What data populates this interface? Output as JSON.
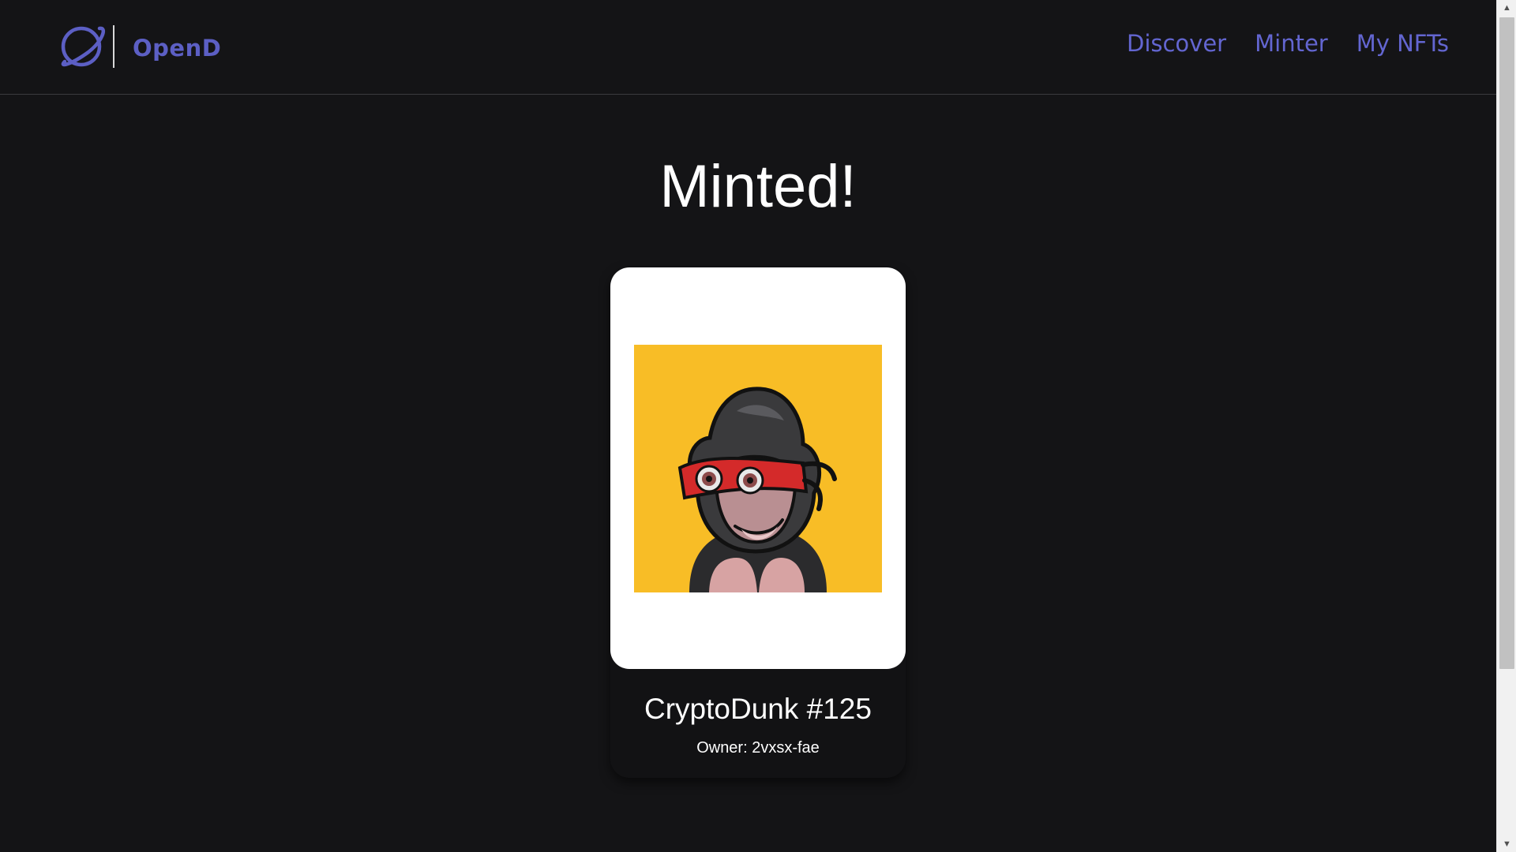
{
  "header": {
    "brand": "OpenD",
    "logo_icon": "planet-icon",
    "nav": [
      {
        "label": "Discover"
      },
      {
        "label": "Minter"
      },
      {
        "label": "My NFTs"
      }
    ],
    "accent_color": "#6366d1"
  },
  "main": {
    "heading": "Minted!"
  },
  "nft_card": {
    "name": "CryptoDunk #125",
    "owner": "Owner: 2vxsx-fae",
    "image": "ape-nft-image",
    "image_background": "#f8bd26"
  },
  "colors": {
    "page_background": "#141416",
    "card_background": "#ffffff"
  }
}
